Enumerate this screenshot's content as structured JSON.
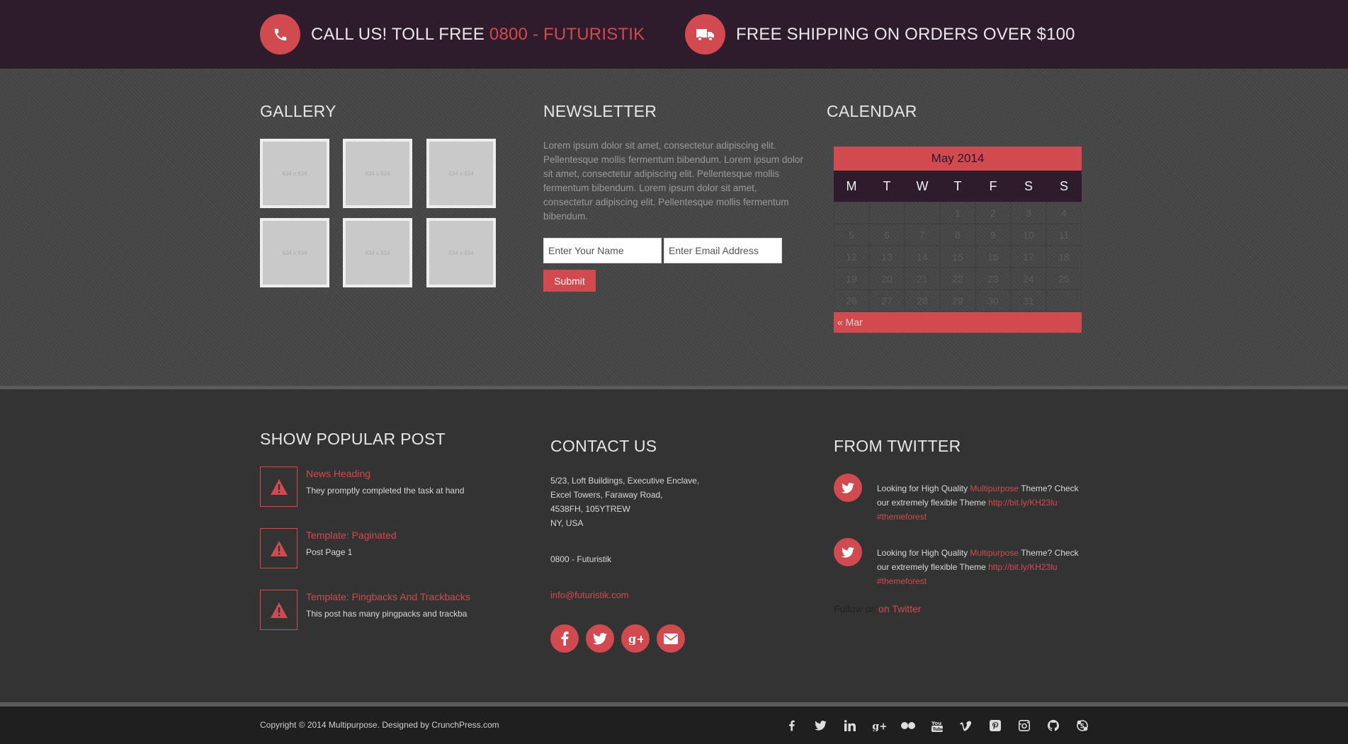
{
  "topbar": {
    "call_prefix": "CALL US! TOLL FREE ",
    "call_number": "0800 - FUTURISTIK",
    "shipping": "FREE SHIPPING ON ORDERS OVER $100",
    "icons": [
      "phone-icon",
      "truck-icon"
    ]
  },
  "gallery": {
    "title": "GALLERY",
    "thumb_label": "634 x 634"
  },
  "newsletter": {
    "title": "NEWSLETTER",
    "text": "Lorem ipsum dolor sit amet, consectetur adipiscing elit. Pellentesque mollis fermentum bibendum. Lorem ipsum dolor sit amet, consectetur adipiscing elit. Pellentesque mollis fermentum bibendum. Lorem ipsum dolor sit amet, consectetur adipiscing elit. Pellentesque mollis fermentum bibendum.",
    "name_placeholder": "Enter Your Name",
    "email_placeholder": "Enter Email Address",
    "submit_label": "Submit"
  },
  "calendar": {
    "title": "CALENDAR",
    "caption": "May 2014",
    "days": [
      "M",
      "T",
      "W",
      "T",
      "F",
      "S",
      "S"
    ],
    "weeks": [
      [
        "",
        "",
        "",
        "1",
        "2",
        "3",
        "4"
      ],
      [
        "5",
        "6",
        "7",
        "8",
        "9",
        "10",
        "11"
      ],
      [
        "12",
        "13",
        "14",
        "15",
        "16",
        "17",
        "18"
      ],
      [
        "19",
        "20",
        "21",
        "22",
        "23",
        "24",
        "25"
      ],
      [
        "26",
        "27",
        "28",
        "29",
        "30",
        "31",
        ""
      ]
    ],
    "prev_link": "« Mar"
  },
  "popular": {
    "title": "SHOW POPULAR POST",
    "posts": [
      {
        "title": "News Heading",
        "sub": "They promptly completed the task at hand"
      },
      {
        "title": "Template: Paginated",
        "sub": "Post Page 1"
      },
      {
        "title": "Template: Pingbacks And Trackbacks",
        "sub": "This post has many pingpacks and trackba"
      }
    ]
  },
  "contact": {
    "title": "CONTACT US",
    "address": [
      "5/23, Loft Buildings, Executive Enclave,",
      "Excel Towers, Faraway Road,",
      "4538FH, 105YTREW",
      "NY, USA"
    ],
    "phone": "0800 - Futuristik",
    "email": "info@futuristik.com",
    "social": [
      "facebook-icon",
      "twitter-icon",
      "google-plus-icon",
      "email-icon"
    ]
  },
  "twitter": {
    "title": "FROM TWITTER",
    "tweets": [
      {
        "pre": "Looking for High Quality ",
        "link1": "Multipurpose",
        "mid": " Theme? Check our extremely flexible Theme ",
        "link2": "http://bit.ly/KH23lu",
        "tag": "#themeforest"
      },
      {
        "pre": "Looking for High Quality ",
        "link1": "Multipurpose",
        "mid": " Theme? Check our extremely flexible Theme ",
        "link2": "http://bit.ly/KH23lu",
        "tag": "#themeforest"
      }
    ],
    "follow_prefix": "Follow us ",
    "follow_link": "on Twitter"
  },
  "bottombar": {
    "copyright": "Copyright © 2014 Multipurpose. Designed by CrunchPress.com",
    "icons": [
      "facebook-icon",
      "twitter-icon",
      "linkedin-icon",
      "google-plus-icon",
      "flickr-icon",
      "youtube-icon",
      "vimeo-icon",
      "pinterest-icon",
      "instagram-icon",
      "github-icon",
      "skype-icon"
    ]
  },
  "colors": {
    "accent": "#d14a50",
    "topbar_bg": "#2e1b2c",
    "widgets_bg": "#464646",
    "footer_bg": "#333333",
    "bottombar_bg": "#1f1f1f"
  }
}
